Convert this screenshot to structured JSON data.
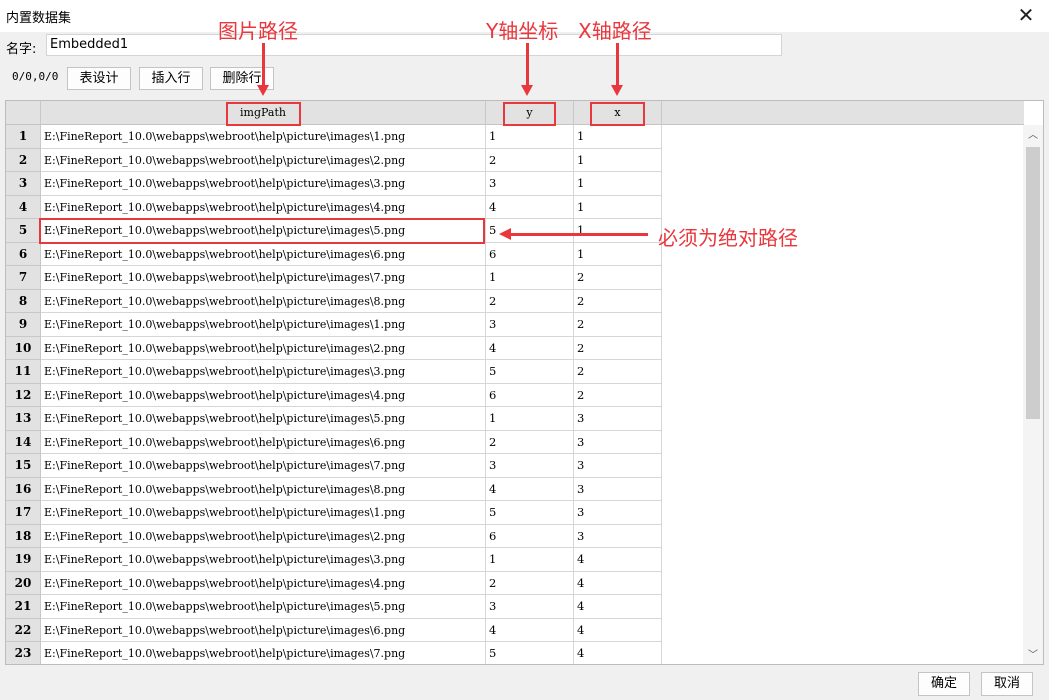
{
  "window": {
    "title": "内置数据集",
    "close_icon": "close-icon"
  },
  "name_field": {
    "label": "名字:",
    "value": "Embedded1"
  },
  "toolbar": {
    "coord_text": "0/0,0/0",
    "table_design": "表设计",
    "insert_row": "插入行",
    "delete_row": "删除行"
  },
  "grid": {
    "columns": [
      "imgPath",
      "y",
      "x"
    ],
    "rows": [
      {
        "n": "1",
        "path": "E:\\FineReport_10.0\\webapps\\webroot\\help\\picture\\images\\1.png",
        "y": "1",
        "x": "1"
      },
      {
        "n": "2",
        "path": "E:\\FineReport_10.0\\webapps\\webroot\\help\\picture\\images\\2.png",
        "y": "2",
        "x": "1"
      },
      {
        "n": "3",
        "path": "E:\\FineReport_10.0\\webapps\\webroot\\help\\picture\\images\\3.png",
        "y": "3",
        "x": "1"
      },
      {
        "n": "4",
        "path": "E:\\FineReport_10.0\\webapps\\webroot\\help\\picture\\images\\4.png",
        "y": "4",
        "x": "1"
      },
      {
        "n": "5",
        "path": "E:\\FineReport_10.0\\webapps\\webroot\\help\\picture\\images\\5.png",
        "y": "5",
        "x": "1"
      },
      {
        "n": "6",
        "path": "E:\\FineReport_10.0\\webapps\\webroot\\help\\picture\\images\\6.png",
        "y": "6",
        "x": "1"
      },
      {
        "n": "7",
        "path": "E:\\FineReport_10.0\\webapps\\webroot\\help\\picture\\images\\7.png",
        "y": "1",
        "x": "2"
      },
      {
        "n": "8",
        "path": "E:\\FineReport_10.0\\webapps\\webroot\\help\\picture\\images\\8.png",
        "y": "2",
        "x": "2"
      },
      {
        "n": "9",
        "path": "E:\\FineReport_10.0\\webapps\\webroot\\help\\picture\\images\\1.png",
        "y": "3",
        "x": "2"
      },
      {
        "n": "10",
        "path": "E:\\FineReport_10.0\\webapps\\webroot\\help\\picture\\images\\2.png",
        "y": "4",
        "x": "2"
      },
      {
        "n": "11",
        "path": "E:\\FineReport_10.0\\webapps\\webroot\\help\\picture\\images\\3.png",
        "y": "5",
        "x": "2"
      },
      {
        "n": "12",
        "path": "E:\\FineReport_10.0\\webapps\\webroot\\help\\picture\\images\\4.png",
        "y": "6",
        "x": "2"
      },
      {
        "n": "13",
        "path": "E:\\FineReport_10.0\\webapps\\webroot\\help\\picture\\images\\5.png",
        "y": "1",
        "x": "3"
      },
      {
        "n": "14",
        "path": "E:\\FineReport_10.0\\webapps\\webroot\\help\\picture\\images\\6.png",
        "y": "2",
        "x": "3"
      },
      {
        "n": "15",
        "path": "E:\\FineReport_10.0\\webapps\\webroot\\help\\picture\\images\\7.png",
        "y": "3",
        "x": "3"
      },
      {
        "n": "16",
        "path": "E:\\FineReport_10.0\\webapps\\webroot\\help\\picture\\images\\8.png",
        "y": "4",
        "x": "3"
      },
      {
        "n": "17",
        "path": "E:\\FineReport_10.0\\webapps\\webroot\\help\\picture\\images\\1.png",
        "y": "5",
        "x": "3"
      },
      {
        "n": "18",
        "path": "E:\\FineReport_10.0\\webapps\\webroot\\help\\picture\\images\\2.png",
        "y": "6",
        "x": "3"
      },
      {
        "n": "19",
        "path": "E:\\FineReport_10.0\\webapps\\webroot\\help\\picture\\images\\3.png",
        "y": "1",
        "x": "4"
      },
      {
        "n": "20",
        "path": "E:\\FineReport_10.0\\webapps\\webroot\\help\\picture\\images\\4.png",
        "y": "2",
        "x": "4"
      },
      {
        "n": "21",
        "path": "E:\\FineReport_10.0\\webapps\\webroot\\help\\picture\\images\\5.png",
        "y": "3",
        "x": "4"
      },
      {
        "n": "22",
        "path": "E:\\FineReport_10.0\\webapps\\webroot\\help\\picture\\images\\6.png",
        "y": "4",
        "x": "4"
      },
      {
        "n": "23",
        "path": "E:\\FineReport_10.0\\webapps\\webroot\\help\\picture\\images\\7.png",
        "y": "5",
        "x": "4"
      }
    ]
  },
  "annotations": {
    "img_path": "图片路径",
    "y_axis": "Y轴坐标",
    "x_path": "X轴路径",
    "absolute_path": "必须为绝对路径",
    "color": "#e8383d"
  },
  "footer": {
    "ok": "确定",
    "cancel": "取消"
  },
  "icons": {
    "scroll_up": "chevron-up-icon",
    "scroll_down": "chevron-down-icon"
  }
}
